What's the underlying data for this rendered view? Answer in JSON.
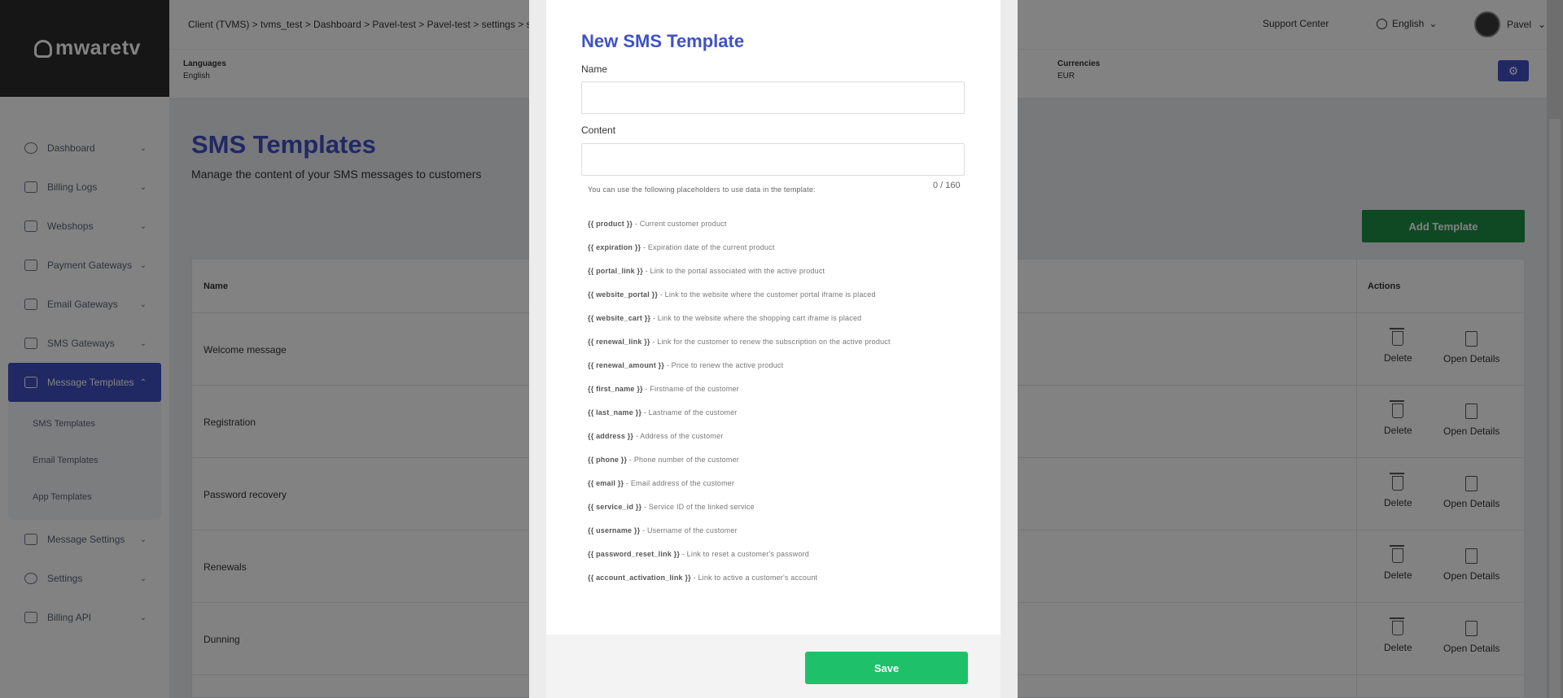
{
  "app": {
    "logo": "mwaretv"
  },
  "header": {
    "breadcrumb": "Client (TVMS)  > tvms_test  > Dashboard  > Pavel-test > Pavel-test > settings > sms",
    "support": "Support Center",
    "language": "English",
    "user": "Pavel"
  },
  "infobar": {
    "languages_label": "Languages",
    "languages_value": "English",
    "currencies_label": "Currencies",
    "currencies_value": "EUR"
  },
  "sidebar": {
    "items": [
      {
        "label": "Dashboard"
      },
      {
        "label": "Billing Logs"
      },
      {
        "label": "Webshops"
      },
      {
        "label": "Payment Gateways"
      },
      {
        "label": "Email Gateways"
      },
      {
        "label": "SMS Gateways"
      },
      {
        "label": "Message Templates"
      },
      {
        "label": "Message Settings"
      },
      {
        "label": "Settings"
      },
      {
        "label": "Billing API"
      }
    ],
    "subitems": [
      {
        "label": "SMS Templates"
      },
      {
        "label": "Email Templates"
      },
      {
        "label": "App Templates"
      }
    ]
  },
  "main": {
    "title": "SMS Templates",
    "subtitle": "Manage the content of your SMS messages to customers",
    "add_button": "Add Template",
    "table": {
      "col_name": "Name",
      "col_actions": "Actions",
      "delete_label": "Delete",
      "details_label": "Open Details",
      "rows": [
        "Welcome message",
        "Registration",
        "Password recovery",
        "Renewals",
        "Dunning"
      ]
    }
  },
  "modal": {
    "title": "New SMS Template",
    "name_label": "Name",
    "content_label": "Content",
    "counter": "0 / 160",
    "hint": "You can use the following placeholders to use data in the template:",
    "placeholders": [
      {
        "key": "{{ product }}",
        "desc": " - Current customer product"
      },
      {
        "key": "{{ expiration }}",
        "desc": " - Expiration date of the current product"
      },
      {
        "key": "{{ portal_link }}",
        "desc": " - Link to the portal associated with the active product"
      },
      {
        "key": "{{ website_portal }}",
        "desc": " - Link to the website where the customer portal iframe is placed"
      },
      {
        "key": "{{ website_cart }}",
        "desc": " - Link to the website where the shopping cart iframe is placed"
      },
      {
        "key": "{{ renewal_link }}",
        "desc": " - Link for the customer to renew the subscription on the active product"
      },
      {
        "key": "{{ renewal_amount }}",
        "desc": " - Price to renew the active product"
      },
      {
        "key": "{{ first_name }}",
        "desc": " - Firstname of the customer"
      },
      {
        "key": "{{ last_name }}",
        "desc": " - Lastname of the customer"
      },
      {
        "key": "{{ address }}",
        "desc": " - Address of the customer"
      },
      {
        "key": "{{ phone }}",
        "desc": " - Phone number of the customer"
      },
      {
        "key": "{{ email }}",
        "desc": " - Email address of the customer"
      },
      {
        "key": "{{ service_id }}",
        "desc": " - Service ID of the linked service"
      },
      {
        "key": "{{ username }}",
        "desc": " - Username of the customer"
      },
      {
        "key": "{{ password_reset_link }}",
        "desc": " - Link to reset a customer's password"
      },
      {
        "key": "{{ account_activation_link }}",
        "desc": " - Link to active a customer's account"
      }
    ],
    "save_button": "Save"
  },
  "colors": {
    "accent": "#3f52c5",
    "add_green": "#1f8f47",
    "save_green": "#1fc06a"
  }
}
